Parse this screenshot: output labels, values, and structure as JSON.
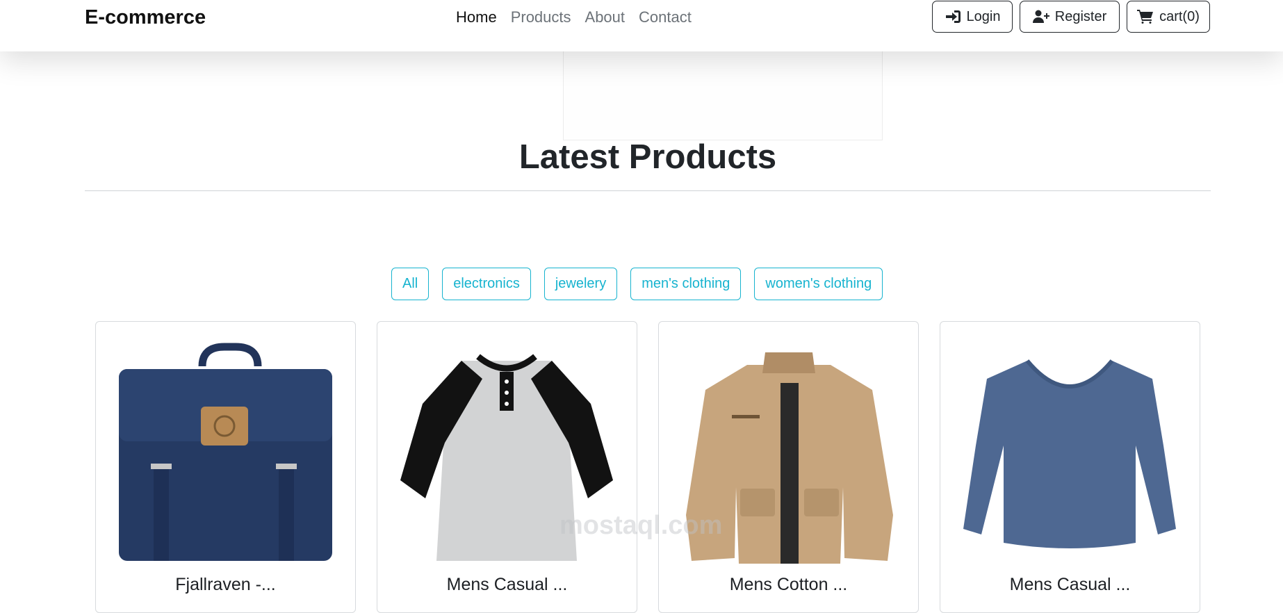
{
  "nav": {
    "brand": "E-commerce",
    "links": [
      "Home",
      "Products",
      "About",
      "Contact"
    ],
    "login": "Login",
    "register": "Register",
    "cart": "cart(0)"
  },
  "page": {
    "title": "Latest Products"
  },
  "filters": [
    "All",
    "electronics",
    "jewelery",
    "men's clothing",
    "women's clothing"
  ],
  "products": [
    {
      "name": "Fjallraven -...",
      "image": "backpack"
    },
    {
      "name": "Mens Casual ...",
      "image": "raglan-tee"
    },
    {
      "name": "Mens Cotton ...",
      "image": "jacket"
    },
    {
      "name": "Mens Casual ...",
      "image": "long-sleeve"
    }
  ],
  "watermark": "mostaql.com",
  "colors": {
    "accent": "#16b3cf",
    "text": "#212529"
  }
}
